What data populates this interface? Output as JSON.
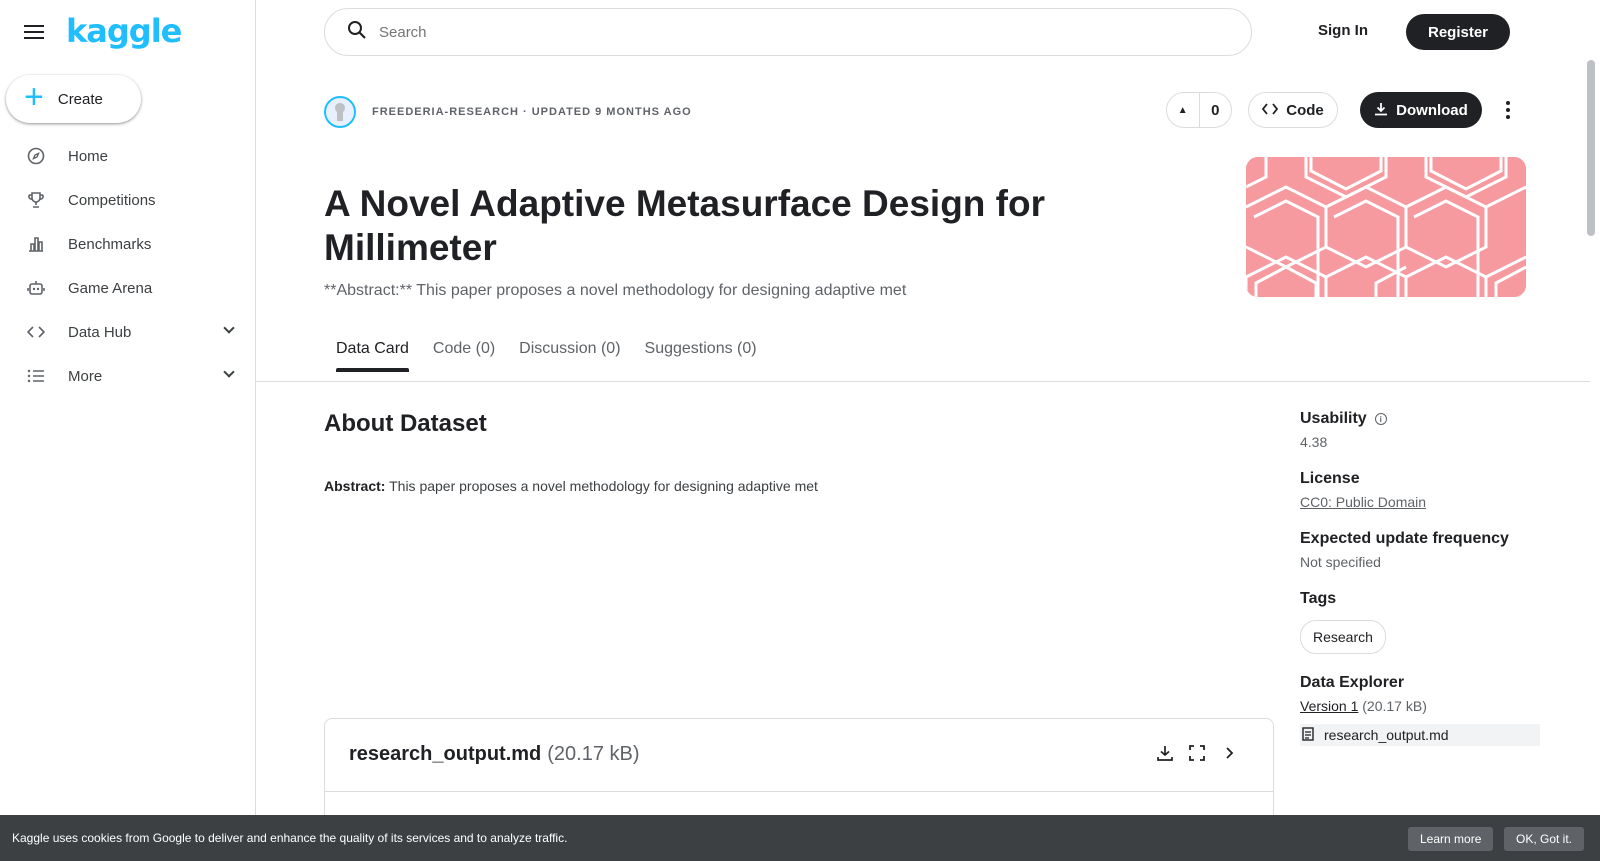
{
  "brand": {
    "logo_text": "kaggle",
    "accent": "#20beff"
  },
  "sidebar": {
    "create_label": "Create",
    "items": [
      {
        "label": "Home",
        "icon": "compass-icon"
      },
      {
        "label": "Competitions",
        "icon": "trophy-icon"
      },
      {
        "label": "Benchmarks",
        "icon": "bar-chart-icon"
      },
      {
        "label": "Game Arena",
        "icon": "robot-icon"
      },
      {
        "label": "Data Hub",
        "icon": "code-icon",
        "expandable": true
      },
      {
        "label": "More",
        "icon": "list-icon",
        "expandable": true
      }
    ]
  },
  "header": {
    "search_placeholder": "Search",
    "signin_label": "Sign In",
    "register_label": "Register"
  },
  "dataset": {
    "owner_meta": "FREEDERIA-RESEARCH · UPDATED 9 MONTHS AGO",
    "vote_count": "0",
    "code_label": "Code",
    "download_label": "Download",
    "title": "A Novel Adaptive Metasurface Design for Millimeter",
    "subtitle": "**Abstract:** This paper proposes a novel methodology for designing adaptive met",
    "cover_color": "#f79aa0"
  },
  "tabs": [
    {
      "label": "Data Card",
      "active": true
    },
    {
      "label": "Code (0)"
    },
    {
      "label": "Discussion (0)"
    },
    {
      "label": "Suggestions (0)"
    }
  ],
  "about": {
    "heading": "About Dataset",
    "abstract_label": "Abstract:",
    "abstract_text": " This paper proposes a novel methodology for designing adaptive met"
  },
  "file_card": {
    "name": "research_output.md",
    "size": "(20.17 kB)"
  },
  "meta": {
    "usability_label": "Usability",
    "usability_value": "4.38",
    "license_label": "License",
    "license_value": "CC0: Public Domain",
    "update_label": "Expected update frequency",
    "update_value": "Not specified",
    "tags_label": "Tags",
    "tag": "Research",
    "explorer_label": "Data Explorer",
    "version_link": "Version 1",
    "version_size": " (20.17 kB)",
    "explorer_file": "research_output.md"
  },
  "cookie": {
    "message": "Kaggle uses cookies from Google to deliver and enhance the quality of its services and to analyze traffic.",
    "learn_more": "Learn more",
    "ok": "OK, Got it."
  }
}
